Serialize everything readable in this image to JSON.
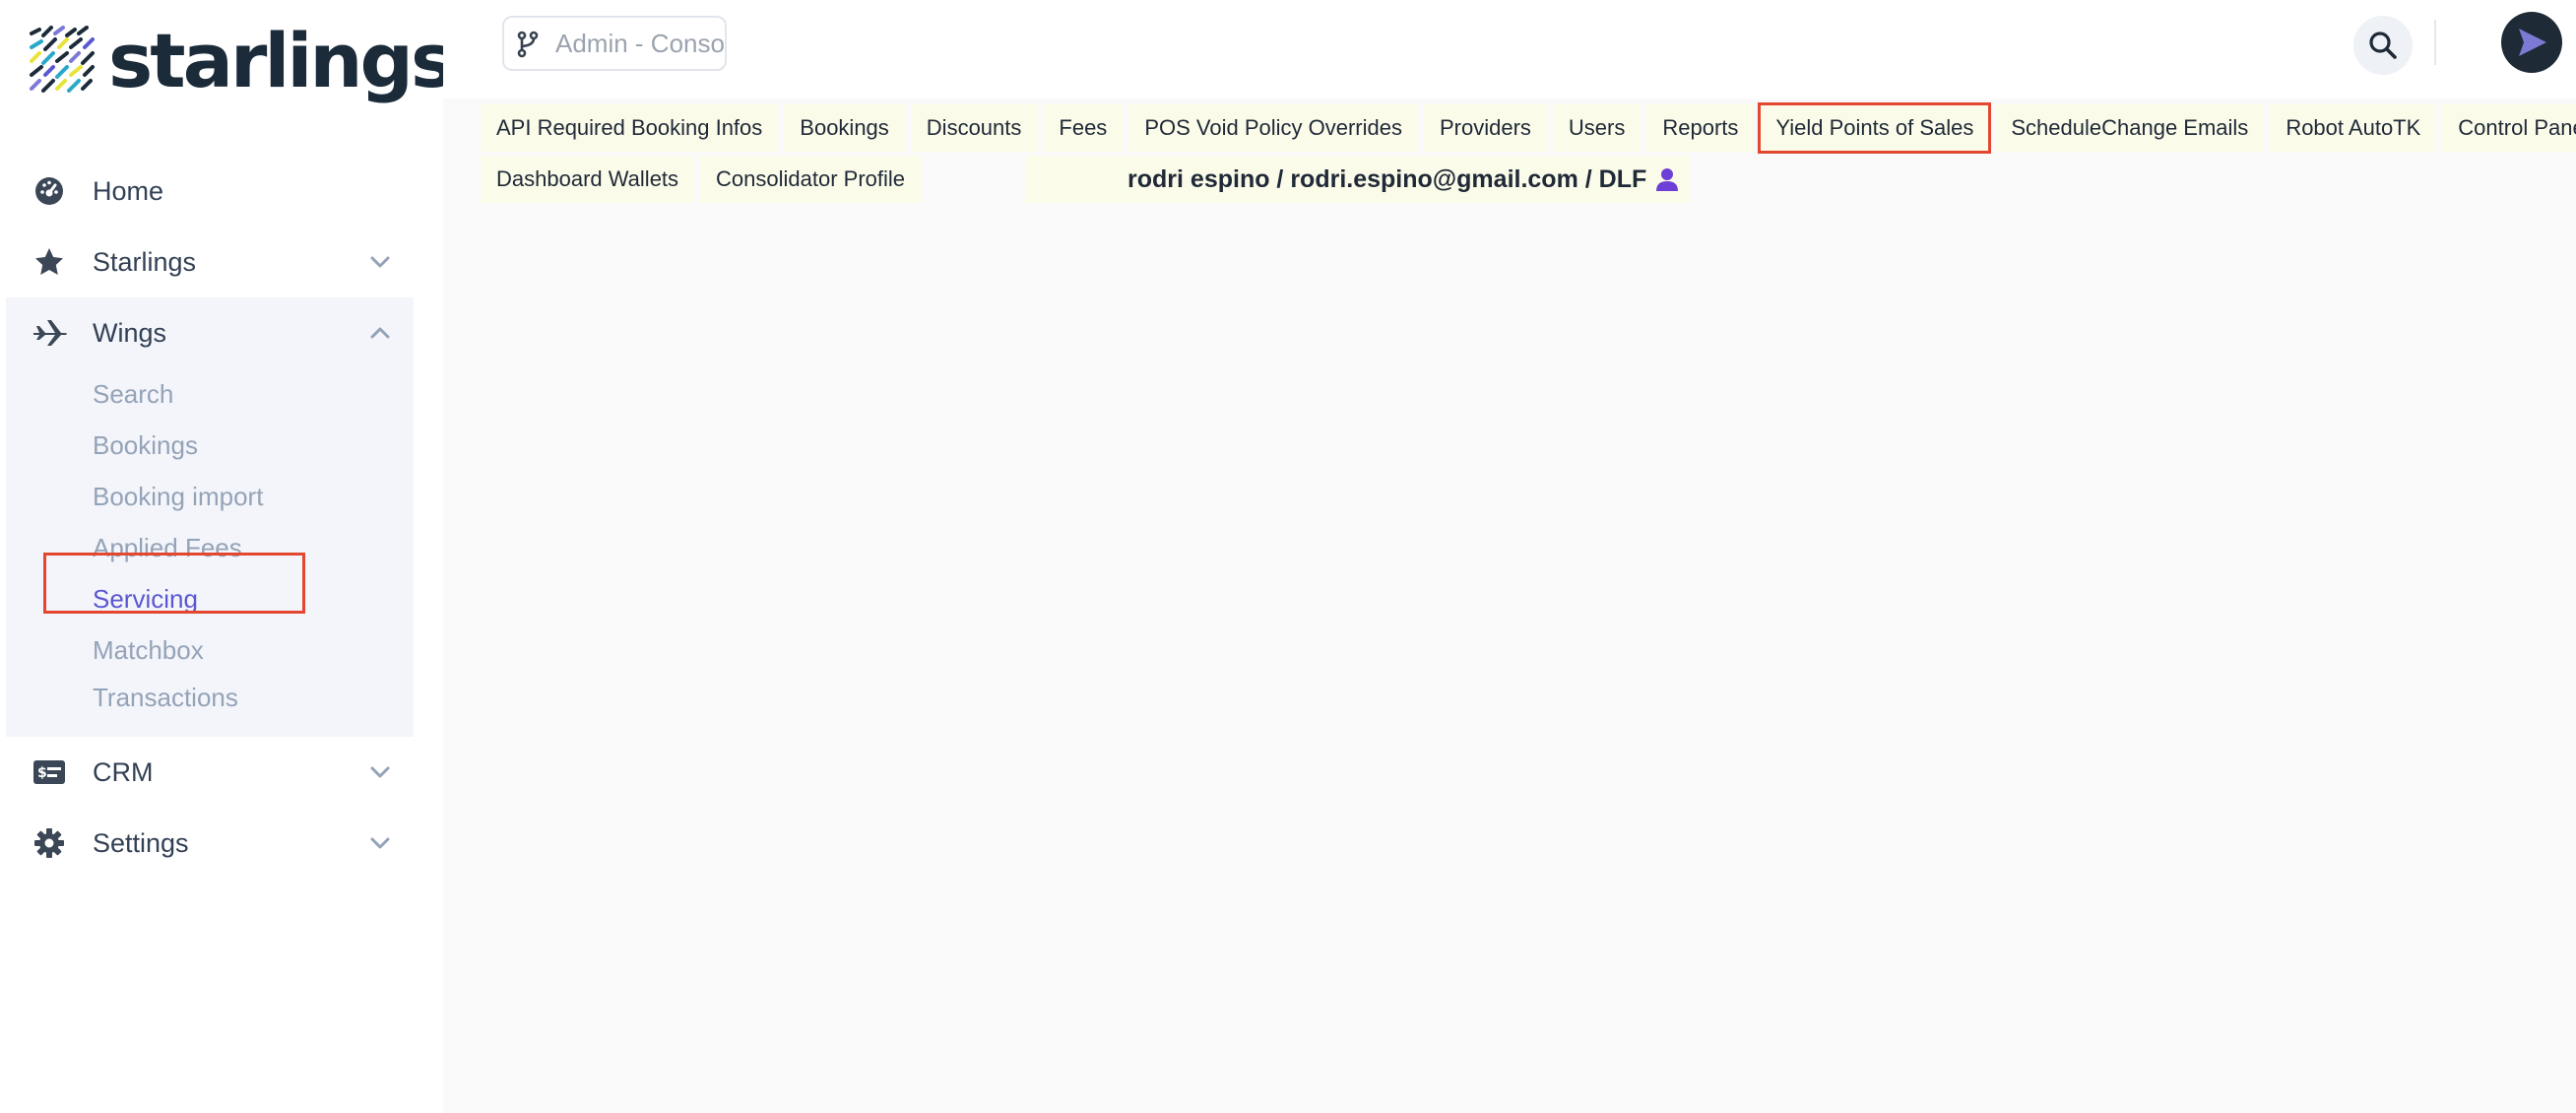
{
  "brand": {
    "name": "starlings"
  },
  "topbar": {
    "app_switcher_placeholder": "Admin - Consoli..."
  },
  "sidebar": {
    "items": [
      {
        "label": "Home",
        "icon": "dashboard-gauge-icon"
      },
      {
        "label": "Starlings",
        "icon": "star-icon",
        "expanded": false
      },
      {
        "label": "Wings",
        "icon": "airplane-icon",
        "expanded": true,
        "children": [
          {
            "label": "Search"
          },
          {
            "label": "Bookings"
          },
          {
            "label": "Booking import"
          },
          {
            "label": "Applied Fees"
          },
          {
            "label": "Servicing",
            "active": true
          },
          {
            "label": "Matchbox"
          },
          {
            "label": "Transactions"
          }
        ]
      },
      {
        "label": "CRM",
        "icon": "money-card-icon",
        "expanded": false
      },
      {
        "label": "Settings",
        "icon": "gear-icon",
        "expanded": false
      }
    ]
  },
  "tabs_row1": [
    "API Required Booking Infos",
    "Bookings",
    "Discounts",
    "Fees",
    "POS Void Policy Overrides",
    "Providers",
    "Users",
    "Reports",
    "Yield Points of Sales",
    "ScheduleChange Emails",
    "Robot AutoTK",
    "Control Panel"
  ],
  "tabs_row2": [
    "Dashboard Wallets",
    "Consolidator Profile"
  ],
  "highlighted_tab": "Yield Points of Sales",
  "user_info": "rodri espino / rodri.espino@gmail.com / DLF",
  "colors": {
    "accent": "#5b57d1",
    "highlight_border": "#e4472f",
    "tab_background": "#fbfbe9",
    "sidebar_group_background": "#f3f5fa",
    "user_icon": "#6d3fd6"
  }
}
